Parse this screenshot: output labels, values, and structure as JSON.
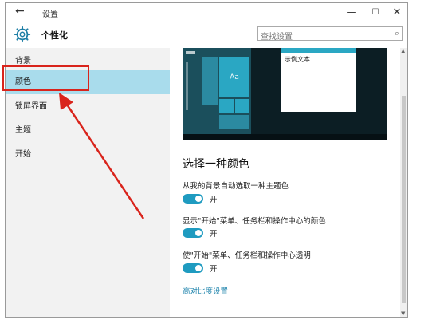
{
  "window": {
    "title": "设置",
    "back_icon": "back-arrow-icon",
    "minimize": "—",
    "maximize": "☐",
    "close": "✕"
  },
  "header": {
    "icon": "gear-icon",
    "title": "个性化",
    "search_placeholder": "查找设置",
    "search_icon": "⌕"
  },
  "sidebar": {
    "items": [
      {
        "label": "背景",
        "selected": false
      },
      {
        "label": "颜色",
        "selected": true
      },
      {
        "label": "锁屏界面",
        "selected": false
      },
      {
        "label": "主题",
        "selected": false
      },
      {
        "label": "开始",
        "selected": false
      }
    ]
  },
  "preview": {
    "sample_text": "示例文本",
    "tile_text": "Aa"
  },
  "main": {
    "section_title": "选择一种颜色",
    "options": [
      {
        "label": "从我的背景自动选取一种主题色",
        "state": "开",
        "on": true
      },
      {
        "label": "显示\"开始\"菜单、任务栏和操作中心的颜色",
        "state": "开",
        "on": true
      },
      {
        "label": "使\"开始\"菜单、任务栏和操作中心透明",
        "state": "开",
        "on": true
      }
    ],
    "link": "高对比度设置"
  },
  "colors": {
    "accent": "#1f9bc0",
    "selected_nav": "#a9dcec",
    "annotation": "#d9241c"
  }
}
